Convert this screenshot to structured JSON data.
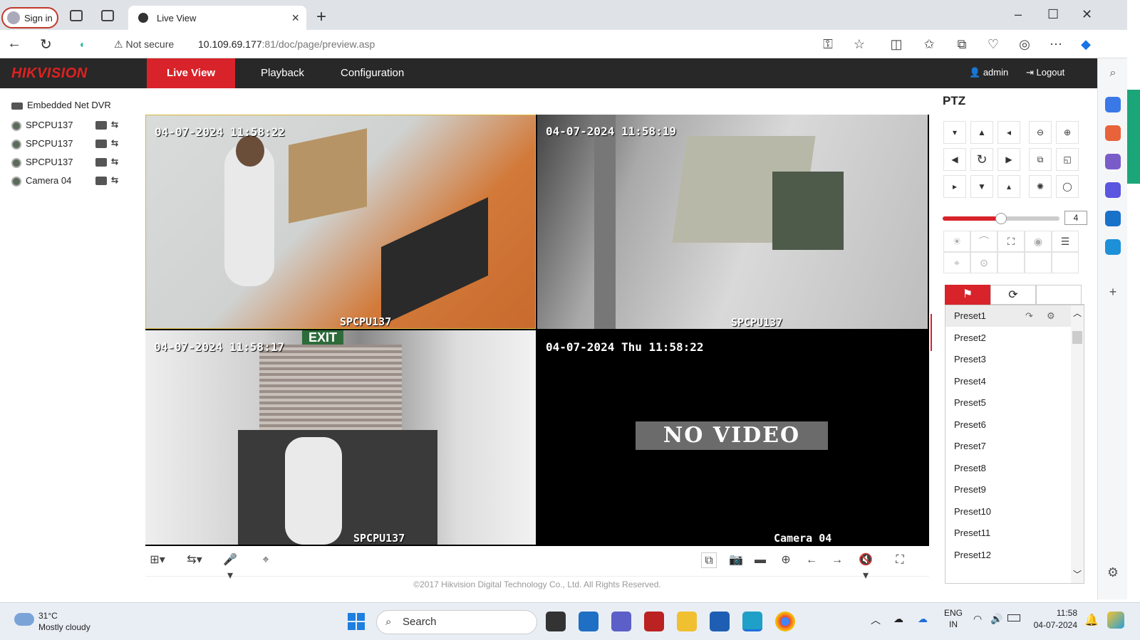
{
  "browser": {
    "signin_label": "Sign in",
    "tab_title": "Live View",
    "security_label": "Not secure",
    "url_host": "10.109.69.177",
    "url_path": ":81/doc/page/preview.asp"
  },
  "app": {
    "logo": "HIKVISION",
    "nav": {
      "live_view": "Live View",
      "playback": "Playback",
      "configuration": "Configuration"
    },
    "user": "admin",
    "logout": "Logout"
  },
  "tree": {
    "root": "Embedded Net DVR",
    "cameras": [
      "SPCPU137",
      "SPCPU137",
      "SPCPU137",
      "Camera 04"
    ]
  },
  "tiles": [
    {
      "timestamp": "04-07-2024 11:58:22",
      "name": "SPCPU137"
    },
    {
      "timestamp": "04-07-2024 11:58:19",
      "name": "SPCPU137"
    },
    {
      "timestamp": "04-07-2024 11:58:17",
      "name": "SPCPU137"
    },
    {
      "timestamp": "04-07-2024 Thu 11:58:22",
      "name": "Camera 04",
      "status": "NO VIDEO"
    }
  ],
  "footer": "©2017 Hikvision Digital Technology Co., Ltd. All Rights Reserved.",
  "ptz": {
    "title": "PTZ",
    "speed": "4",
    "speed_level": 0.5,
    "presets": [
      "Preset1",
      "Preset2",
      "Preset3",
      "Preset4",
      "Preset5",
      "Preset6",
      "Preset7",
      "Preset8",
      "Preset9",
      "Preset10",
      "Preset11",
      "Preset12"
    ]
  },
  "taskbar": {
    "temp": "31°C",
    "weather": "Mostly cloudy",
    "search": "Search",
    "lang1": "ENG",
    "lang2": "IN",
    "time": "11:58",
    "date": "04-07-2024"
  },
  "colors": {
    "accent": "#d8232a",
    "header_bg": "#282828"
  }
}
